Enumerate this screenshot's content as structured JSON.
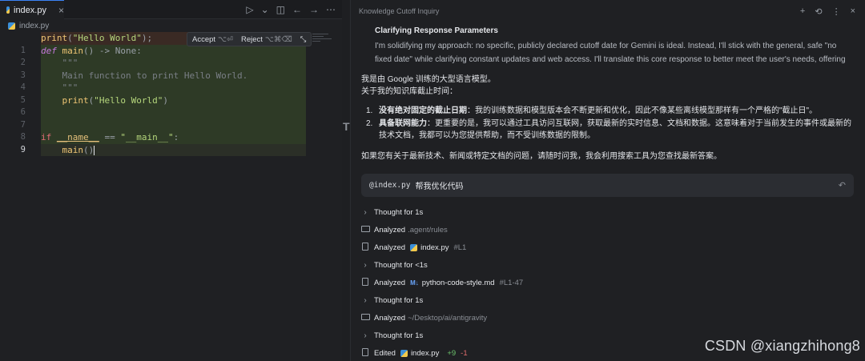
{
  "editor": {
    "tab_label": "index.py",
    "tab_close": "×",
    "breadcrumb": "index.py",
    "accept_label": "Accept",
    "accept_kbd": "⌥⏎",
    "reject_label": "Reject",
    "reject_kbd": "⌥⌘⌫",
    "lines": [
      {
        "num": "",
        "tokens": [
          [
            "fn",
            "print"
          ],
          [
            "op",
            "("
          ],
          [
            "str",
            "\"Hello World\""
          ],
          [
            "op",
            ");"
          ]
        ],
        "style": "del"
      },
      {
        "num": "1",
        "tokens": [
          [
            "kw",
            "def"
          ],
          [
            "",
            " "
          ],
          [
            "fn",
            "main"
          ],
          [
            "op",
            "() -> "
          ],
          [
            "op",
            "None:"
          ]
        ],
        "style": "add"
      },
      {
        "num": "2",
        "tokens": [
          [
            "",
            "    "
          ],
          [
            "cmt",
            "\"\"\""
          ]
        ],
        "style": "add"
      },
      {
        "num": "3",
        "tokens": [
          [
            "",
            "    "
          ],
          [
            "cmt",
            "Main function to print Hello World."
          ]
        ],
        "style": "add"
      },
      {
        "num": "4",
        "tokens": [
          [
            "",
            "    "
          ],
          [
            "cmt",
            "\"\"\""
          ]
        ],
        "style": "add"
      },
      {
        "num": "5",
        "tokens": [
          [
            "",
            "    "
          ],
          [
            "fn",
            "print"
          ],
          [
            "op",
            "("
          ],
          [
            "str",
            "\"Hello World\""
          ],
          [
            "op",
            ")"
          ]
        ],
        "style": "add"
      },
      {
        "num": "6",
        "tokens": [],
        "style": "add"
      },
      {
        "num": "7",
        "tokens": [],
        "style": "add"
      },
      {
        "num": "8",
        "tokens": [
          [
            "kw2",
            "if"
          ],
          [
            "",
            " "
          ],
          [
            "dunder",
            "__name__"
          ],
          [
            "op",
            " == "
          ],
          [
            "str",
            "\"__main__\""
          ],
          [
            "op",
            ":"
          ]
        ],
        "style": "add"
      },
      {
        "num": "9",
        "tokens": [
          [
            "",
            "    "
          ],
          [
            "fn",
            "main"
          ],
          [
            "op",
            "()"
          ]
        ],
        "style": "cur"
      }
    ]
  },
  "panel": {
    "title": "Knowledge Cutoff Inquiry",
    "actions": [
      "+",
      "⟲",
      "⋮",
      "×"
    ],
    "think_title": "Clarifying Response Parameters",
    "think_body": "I'm solidifying my approach: no specific, publicly declared cutoff date for Gemini is ideal. Instead, I'll stick with the general, safe \"no fixed date\" while clarifying constant updates and web access. I'll translate this core response to better meet the user's needs, offering",
    "answer_line1": "我是由 Google 训练的大型语言模型。",
    "answer_line2": "关于我的知识库截止时间：",
    "list": [
      {
        "num": "1.",
        "bold": "没有绝对固定的截止日期",
        "text": "：我的训练数据和模型版本会不断更新和优化，因此不像某些离线模型那样有一个严格的\"截止日\"。"
      },
      {
        "num": "2.",
        "bold": "具备联网能力",
        "text": "：更重要的是，我可以通过工具访问互联网，获取最新的实时信息、文档和数据。这意味着对于当前发生的事件或最新的技术文档，我都可以为您提供帮助，而不受训练数据的限制。"
      }
    ],
    "closing": "如果您有关于最新技术、新闻或特定文档的问题，请随时问我，我会利用搜索工具为您查找最新答案。",
    "user_mention": "@index.py",
    "user_text": "帮我优化代码",
    "steps": [
      {
        "icon": "chevron",
        "verb": "Thought for 1s",
        "file": "",
        "suffix": ""
      },
      {
        "icon": "folder",
        "verb": "Analyzed",
        "file": "",
        "suffix": ".agent/rules"
      },
      {
        "icon": "doc",
        "verb": "Analyzed",
        "file": "index.py",
        "file_icon": "py",
        "suffix": "#L1"
      },
      {
        "icon": "chevron",
        "verb": "Thought for <1s",
        "file": "",
        "suffix": ""
      },
      {
        "icon": "doc",
        "verb": "Analyzed",
        "file": "python-code-style.md",
        "file_icon": "md",
        "suffix": "#L1-47"
      },
      {
        "icon": "chevron",
        "verb": "Thought for 1s",
        "file": "",
        "suffix": ""
      },
      {
        "icon": "folder",
        "verb": "Analyzed",
        "file": "",
        "suffix": "~/Desktop/ai/antigravity"
      },
      {
        "icon": "chevron",
        "verb": "Thought for 1s",
        "file": "",
        "suffix": ""
      },
      {
        "icon": "doc",
        "verb": "Edited",
        "file": "index.py",
        "file_icon": "py",
        "suffix": "",
        "added": "+9",
        "removed": "-1"
      }
    ]
  },
  "watermark": "CSDN @xiangzhihong8"
}
